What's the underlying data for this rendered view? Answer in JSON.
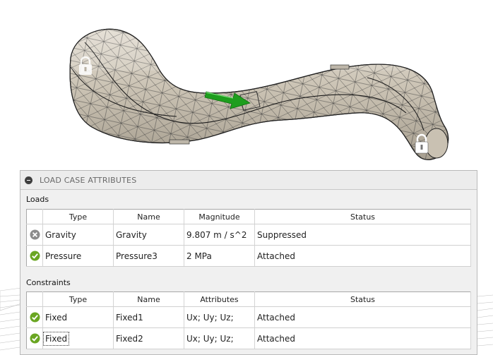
{
  "panel": {
    "title": "LOAD CASE ATTRIBUTES"
  },
  "loads": {
    "label": "Loads",
    "columns": [
      "",
      "Type",
      "Name",
      "Magnitude",
      "Status"
    ],
    "rows": [
      {
        "status_icon": "suppressed-icon",
        "type": "Gravity",
        "name": "Gravity",
        "magnitude": "9.807 m / s^2",
        "status": "Suppressed"
      },
      {
        "status_icon": "check-icon",
        "type": "Pressure",
        "name": "Pressure3",
        "magnitude": "2 MPa",
        "status": "Attached"
      }
    ]
  },
  "constraints": {
    "label": "Constraints",
    "columns": [
      "",
      "Type",
      "Name",
      "Attributes",
      "Status"
    ],
    "rows": [
      {
        "status_icon": "check-icon",
        "type": "Fixed",
        "name": "Fixed1",
        "attributes": "Ux; Uy; Uz;",
        "status": "Attached"
      },
      {
        "status_icon": "check-icon",
        "type": "Fixed",
        "name": "Fixed2",
        "attributes": "Ux; Uy; Uz;",
        "status": "Attached"
      }
    ]
  },
  "viewport": {
    "model": "meshed-curved-part",
    "glyphs": [
      "lock-icon",
      "lock-icon",
      "load-arrow-icon"
    ],
    "colors": {
      "body": "#ccc4b6",
      "mesh": "#2a2a2a",
      "arrow": "#1e9e1e",
      "check": "#6aa622",
      "suppressed": "#8c8c8c"
    }
  }
}
